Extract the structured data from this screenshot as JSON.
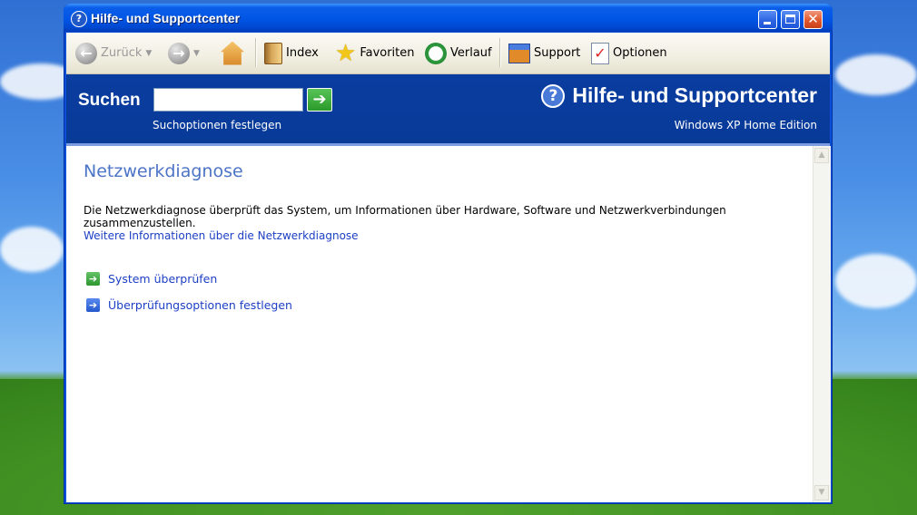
{
  "window": {
    "title": "Hilfe- und Supportcenter"
  },
  "toolbar": {
    "back_label": "Zurück",
    "index_label": "Index",
    "favorites_label": "Favoriten",
    "history_label": "Verlauf",
    "support_label": "Support",
    "options_label": "Optionen"
  },
  "search": {
    "label": "Suchen",
    "input_value": "",
    "options_link": "Suchoptionen festlegen"
  },
  "brand": {
    "title": "Hilfe- und Supportcenter",
    "edition": "Windows XP Home Edition"
  },
  "content": {
    "heading": "Netzwerkdiagnose",
    "description": "Die Netzwerkdiagnose überprüft das System, um Informationen über Hardware, Software und Netzwerkverbindungen zusammenzustellen.",
    "more_info_link": "Weitere Informationen über die Netzwerkdiagnose",
    "actions": [
      {
        "label": "System überprüfen",
        "icon": "green-arrow-icon"
      },
      {
        "label": "Überprüfungsoptionen festlegen",
        "icon": "blue-arrow-icon"
      }
    ]
  },
  "colors": {
    "title_bar": "#0055e5",
    "search_band": "#0a3da0",
    "heading": "#4d74c6",
    "link": "#1c3fc4"
  }
}
